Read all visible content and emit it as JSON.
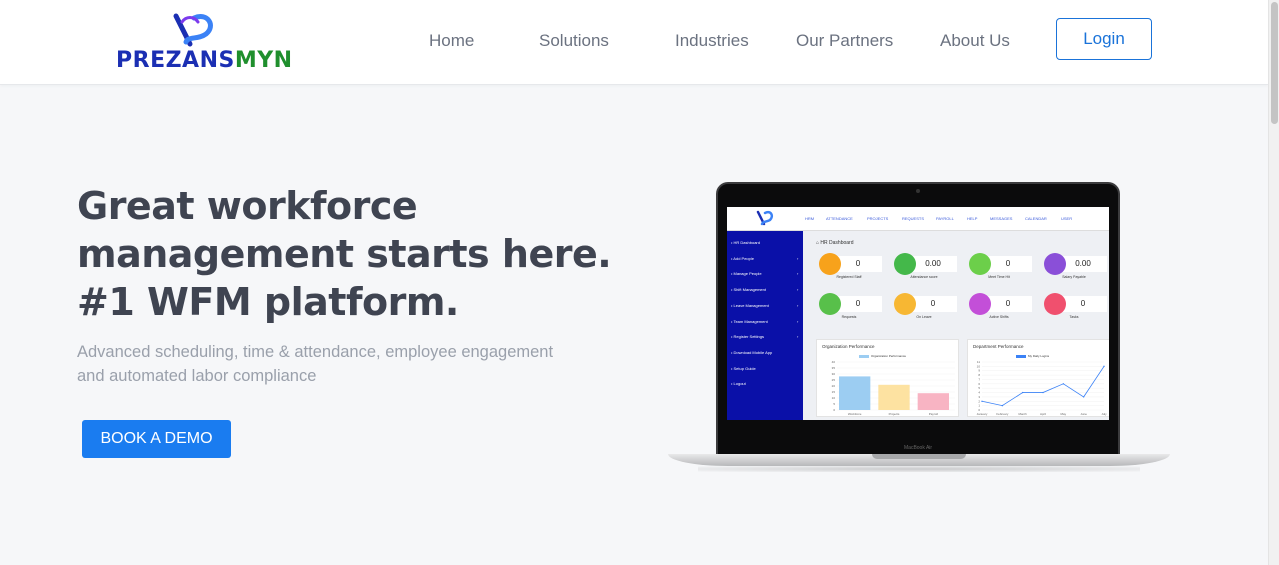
{
  "header": {
    "logo_part1": "PREZANS",
    "logo_part2": "MYN",
    "nav": [
      {
        "label": "Home"
      },
      {
        "label": "Solutions"
      },
      {
        "label": "Industries"
      },
      {
        "label": "Our Partners"
      },
      {
        "label": "About Us"
      }
    ],
    "login_label": "Login"
  },
  "hero": {
    "title_lines": [
      "Great workforce",
      "management starts here.",
      "#1 WFM platform."
    ],
    "subtitle_lines": [
      "Advanced scheduling, time & attendance, employee engagement",
      "and automated labor compliance"
    ],
    "cta_label": "BOOK A DEMO"
  },
  "colors": {
    "accent": "#1a7cf0",
    "logo_blue": "#1b2fb3",
    "logo_green": "#1f8f2d",
    "sidebar": "#0a10a8"
  },
  "mockup": {
    "device_label": "MacBook Air",
    "nav": [
      "HRM",
      "ATTENDANCE",
      "PROJECTS",
      "REQUESTS",
      "PAYROLL",
      "HELP",
      "MESSAGES",
      "CALENDAR",
      "USER"
    ],
    "sidebar": [
      {
        "label": "HR Dashboard",
        "chevron": ""
      },
      {
        "label": "Add People",
        "chevron": "›"
      },
      {
        "label": "Manage People",
        "chevron": "›"
      },
      {
        "label": "Shift Management",
        "chevron": "›"
      },
      {
        "label": "Leave Management",
        "chevron": "›"
      },
      {
        "label": "Team Management",
        "chevron": "›"
      },
      {
        "label": "Register Settings",
        "chevron": "›"
      },
      {
        "label": "Download Mobile App",
        "chevron": ""
      },
      {
        "label": "Setup Guide",
        "chevron": ""
      },
      {
        "label": "Logout",
        "chevron": ""
      }
    ],
    "dashboard_title": "HR Dashboard",
    "stats": [
      {
        "label": "Registered Staff",
        "value": "0",
        "color": "#f7a21b"
      },
      {
        "label": "Attendance score",
        "value": "0.00",
        "color": "#44b84a"
      },
      {
        "label": "Meet Time Hit",
        "value": "0",
        "color": "#6ccf4a"
      },
      {
        "label": "Salary Payable",
        "value": "0.00",
        "color": "#8a4fd8"
      },
      {
        "label": "Requests",
        "value": "0",
        "color": "#58c04a"
      },
      {
        "label": "On Leave",
        "value": "0",
        "color": "#f7b733"
      },
      {
        "label": "Active Shifts",
        "value": "0",
        "color": "#c34fd8"
      },
      {
        "label": "Tasks",
        "value": "0",
        "color": "#f0506e"
      }
    ],
    "org_chart": {
      "title": "Organization Performance",
      "legend": "Organization Performance",
      "categories": [
        "Workforce",
        "Projects",
        "Payroll"
      ],
      "values": [
        28,
        21,
        14
      ],
      "bar_colors": [
        "#9ccdf2",
        "#fde2a1",
        "#f8b4c3"
      ],
      "ylim": [
        0,
        40
      ],
      "yticks": [
        "40",
        "35",
        "30",
        "25",
        "20",
        "15",
        "10",
        "5",
        "0"
      ]
    },
    "dept_chart": {
      "title": "Department Performance",
      "legend": "My Daily Logins",
      "categories": [
        "January",
        "February",
        "March",
        "April",
        "May",
        "June",
        "July"
      ],
      "values": [
        2,
        1,
        4,
        4,
        6,
        3,
        10
      ],
      "ylim": [
        0,
        11
      ],
      "yticks": [
        "11",
        "10",
        "9",
        "8",
        "7",
        "6",
        "5",
        "4",
        "3",
        "2",
        "1",
        "0"
      ]
    }
  }
}
